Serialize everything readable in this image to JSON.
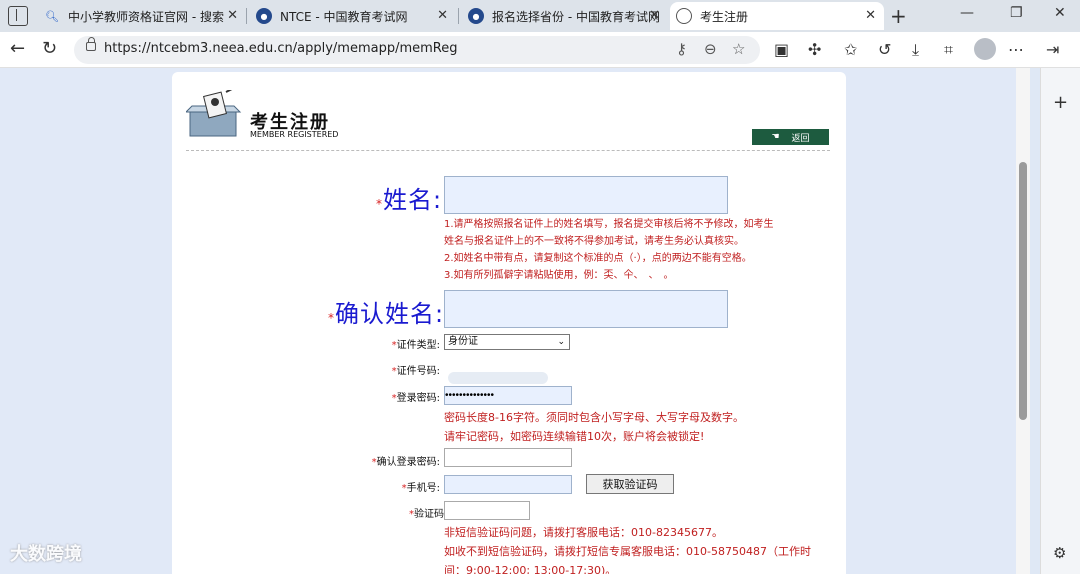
{
  "tabs": [
    {
      "label": "中小学教师资格证官网 - 搜索",
      "icon": "search-icon"
    },
    {
      "label": "NTCE - 中国教育考试网",
      "icon": "seal-icon"
    },
    {
      "label": "报名选择省份 - 中国教育考试网",
      "icon": "seal-icon"
    },
    {
      "label": "考生注册",
      "icon": "globe-icon",
      "active": true
    }
  ],
  "address": {
    "url": "https://ntcebm3.neea.edu.cn/apply/memapp/memReg"
  },
  "page": {
    "title": "考生注册",
    "subtitle": "MEMBER REGISTERED",
    "back_label": "返回"
  },
  "form": {
    "name_label": "姓名:",
    "name_notes": [
      "1.请严格按照报名证件上的姓名填写，报名提交审核后将不予修改，如考生",
      "姓名与报名证件上的不一致将不得参加考试，请考生务必认真核实。",
      "2.如姓名中带有点，请复制这个标准的点（·），点的两边不能有空格。",
      "3.如有所列孤僻字请粘贴使用，例：奀、仐、　、　。"
    ],
    "confirm_name_label": "确认姓名:",
    "id_type_label": "证件类型:",
    "id_type_value": "身份证",
    "id_number_label": "证件号码:",
    "password_label": "登录密码:",
    "password_value": "••••••••••••••",
    "password_notes": [
      "密码长度8-16字符。须同时包含小写字母、大写字母及数字。",
      "请牢记密码，如密码连续输错10次，账户将会被锁定!"
    ],
    "confirm_password_label": "确认登录密码:",
    "phone_label": "手机号:",
    "get_code_label": "获取验证码",
    "code_label": "验证码",
    "sms_notes": [
      "非短信验证码问题，请拨打客服电话：010-82345677。",
      "如收不到短信验证码，请拨打短信专属客服电话：010-58750487（工作时",
      "间：9:00-12:00; 13:00-17:30)。"
    ]
  },
  "watermark": "大数跨境",
  "colors": {
    "label_blue": "#1a1ad0",
    "note_red": "#c02020",
    "back_green": "#1d5b3f"
  }
}
